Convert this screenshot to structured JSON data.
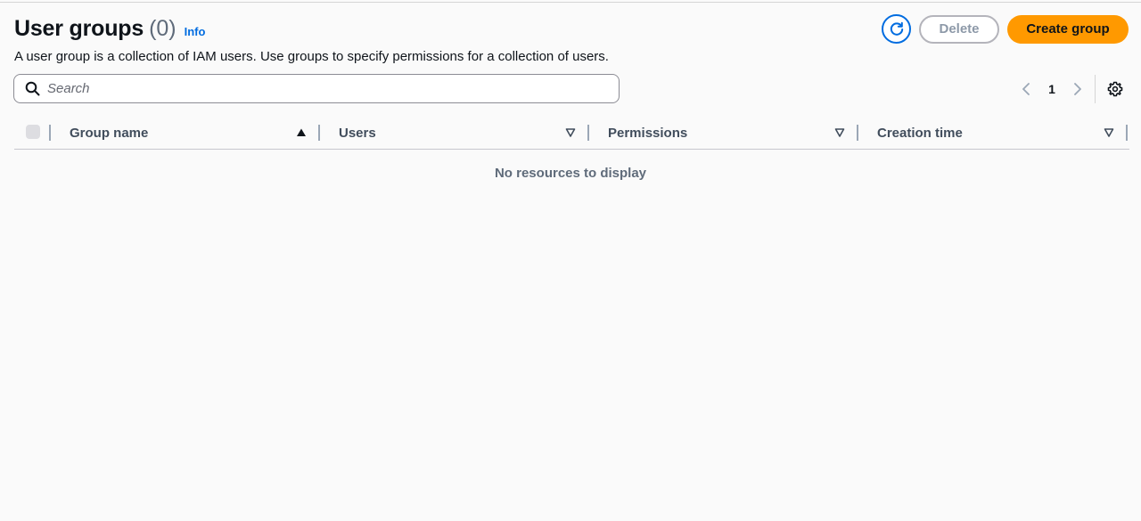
{
  "header": {
    "title": "User groups",
    "count": "(0)",
    "info_label": "Info",
    "description": "A user group is a collection of IAM users. Use groups to specify permissions for a collection of users."
  },
  "actions": {
    "refresh_icon": "refresh-icon",
    "delete_label": "Delete",
    "create_label": "Create group"
  },
  "search": {
    "placeholder": "Search",
    "value": ""
  },
  "pagination": {
    "current_page": "1"
  },
  "table": {
    "columns": [
      {
        "label": "Group name",
        "sort": "ascending"
      },
      {
        "label": "Users",
        "sort": "none"
      },
      {
        "label": "Permissions",
        "sort": "none"
      },
      {
        "label": "Creation time",
        "sort": "none"
      }
    ],
    "empty_message": "No resources to display"
  },
  "colors": {
    "primary_button": "#ff9900",
    "link": "#006ce0",
    "background": "#fafafa"
  }
}
